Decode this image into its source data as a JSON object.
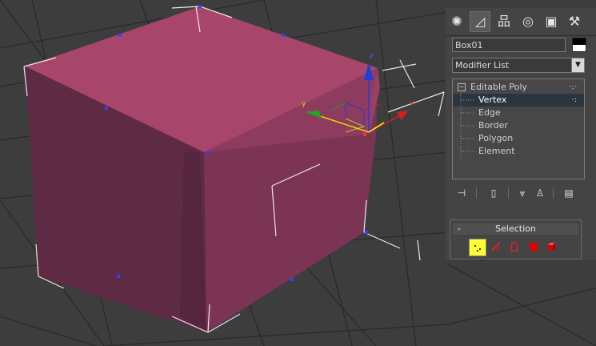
{
  "command_panel": {
    "tabs": [
      {
        "name": "create",
        "icon": "sun-gear-icon",
        "glyph": "✺"
      },
      {
        "name": "modify",
        "icon": "modify-bend-icon",
        "glyph": "◿"
      },
      {
        "name": "hierarchy",
        "icon": "hierarchy-icon",
        "glyph": "品"
      },
      {
        "name": "motion",
        "icon": "motion-circle-icon",
        "glyph": "◎"
      },
      {
        "name": "display",
        "icon": "display-monitor-icon",
        "glyph": "▣"
      },
      {
        "name": "utilities",
        "icon": "hammer-icon",
        "glyph": "⚒"
      }
    ],
    "active_tab": "modify",
    "object_name": "Box01",
    "modifier_list_label": "Modifier List",
    "stack": [
      {
        "label": "Editable Poly",
        "level": 0,
        "selected": false,
        "expand": "−"
      },
      {
        "label": "Vertex",
        "level": 1,
        "selected": true
      },
      {
        "label": "Edge",
        "level": 1,
        "selected": false
      },
      {
        "label": "Border",
        "level": 1,
        "selected": false
      },
      {
        "label": "Polygon",
        "level": 1,
        "selected": false
      },
      {
        "label": "Element",
        "level": 1,
        "selected": false
      }
    ],
    "stack_toolbar": [
      {
        "name": "pin-stack-icon",
        "glyph": "⊣"
      },
      {
        "name": "show-end-result-icon",
        "glyph": "▯"
      },
      {
        "name": "make-unique-icon",
        "glyph": "⩔"
      },
      {
        "name": "remove-modifier-icon",
        "glyph": "♙"
      },
      {
        "name": "configure-modifier-sets-icon",
        "glyph": "▤"
      }
    ]
  },
  "selection_rollout": {
    "collapse_glyph": "-",
    "title": "Selection",
    "subobject_icons": [
      "vertex-icon",
      "edge-icon",
      "border-icon",
      "polygon-icon",
      "element-icon"
    ],
    "active_subobject": "vertex"
  },
  "gizmo": {
    "x_label": "x",
    "y_label": "y",
    "z_label": "z"
  },
  "colors": {
    "object_top": "#a8456a",
    "object_front": "#5f2b44",
    "object_right": "#8a3a5c",
    "gizmo_x": "#d22020",
    "gizmo_y": "#1fa81f",
    "gizmo_z": "#1f3fd8",
    "selected_stack_bg": "#2a3540",
    "vertex_active_bg": "#ffff33"
  }
}
